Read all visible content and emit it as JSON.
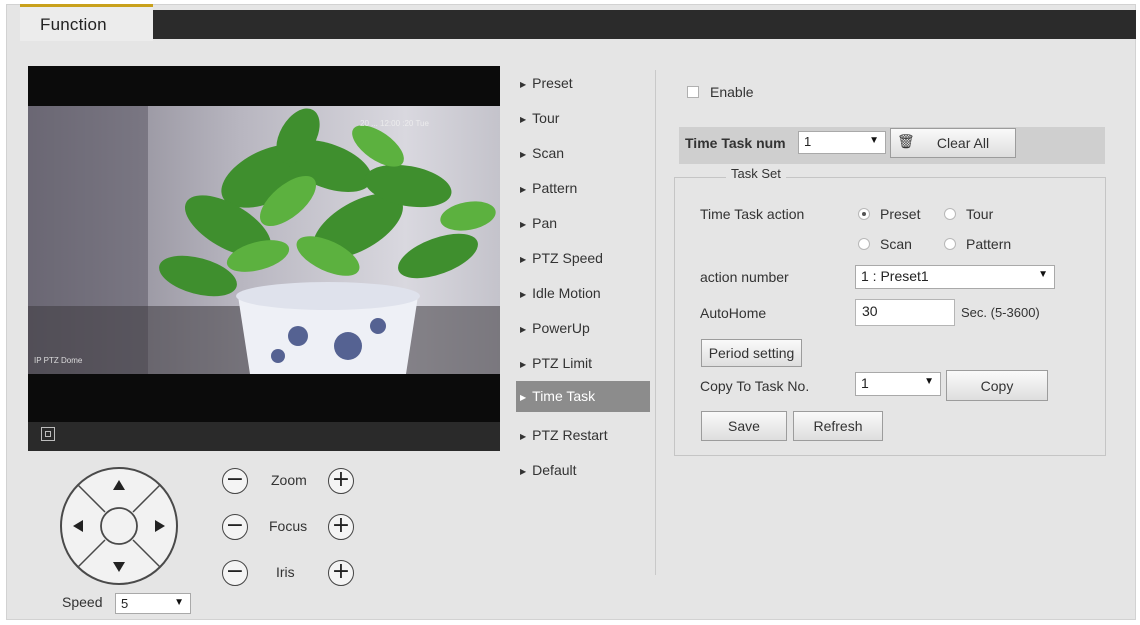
{
  "tabs": {
    "function": "Function"
  },
  "video": {
    "osd_time": "20 ... 12:00 :20 Tue",
    "osd_name": "IP PTZ Dome"
  },
  "ptz": {
    "zoom_label": "Zoom",
    "focus_label": "Focus",
    "iris_label": "Iris",
    "minus": "−",
    "plus": "+",
    "speed_label": "Speed",
    "speed_value": "5"
  },
  "menu": {
    "items": [
      "Preset",
      "Tour",
      "Scan",
      "Pattern",
      "Pan",
      "PTZ Speed",
      "Idle Motion",
      "PowerUp",
      "PTZ Limit",
      "Time Task",
      "PTZ Restart",
      "Default"
    ],
    "active": "Time Task"
  },
  "time_task": {
    "enable_label": "Enable",
    "enable_checked": false,
    "task_num_label": "Time Task num",
    "task_num_value": "1",
    "clear_all_label": "Clear All",
    "task_set_legend": "Task Set",
    "action_label": "Time Task action",
    "actions": [
      "Preset",
      "Tour",
      "Scan",
      "Pattern"
    ],
    "selected_action": "Preset",
    "action_number_label": "action number",
    "action_number_value": "1 : Preset1",
    "autohome_label": "AutoHome",
    "autohome_value": "30",
    "autohome_unit": "Sec. (5-3600)",
    "period_setting_label": "Period setting",
    "copy_to_label": "Copy To Task No.",
    "copy_to_value": "1",
    "copy_label": "Copy",
    "save_label": "Save",
    "refresh_label": "Refresh"
  },
  "icons": {
    "dropdown": "▼",
    "menu_arrow": "▶",
    "trash": "🗑"
  },
  "colors": {
    "accent": "#c9a11c",
    "active_menu": "#8c8c8c",
    "tab_bar": "#2b2b2b"
  }
}
